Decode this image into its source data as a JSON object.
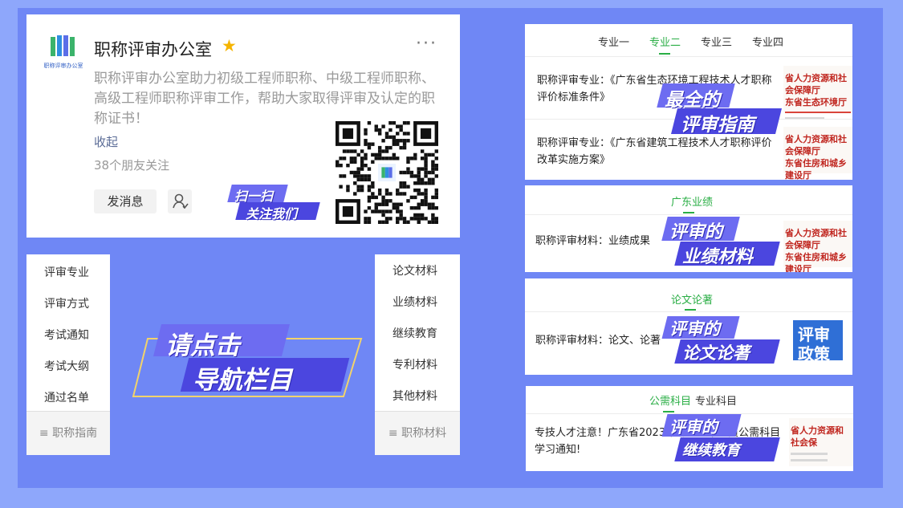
{
  "profile": {
    "logo_text": "职称评审办公室",
    "title": "职称评审办公室",
    "description": "职称评审办公室助力初级工程师职称、中级工程师职称、高级工程师职称评审工作，帮助大家取得评审及认定的职称证书！",
    "collapse": "收起",
    "followers": "38个朋友关注",
    "message_button": "发消息",
    "more": "···"
  },
  "stickers": {
    "scan_line1": "扫一扫",
    "scan_line2": "关注我们",
    "nav_line1": "请点击",
    "nav_line2": "导航栏目",
    "guide_line1": "最全的",
    "guide_line2": "评审指南",
    "perf_line1": "评审的",
    "perf_line2": "业绩材料",
    "paper_line1": "评审的",
    "paper_line2": "论文论著",
    "edu_line1": "评审的",
    "edu_line2": "继续教育",
    "policy_line1": "评审",
    "policy_line2": "政策"
  },
  "menu_left": {
    "items": [
      "评审专业",
      "评审方式",
      "考试通知",
      "考试大纲",
      "通过名单"
    ],
    "footer": "职称指南"
  },
  "menu_right": {
    "items": [
      "论文材料",
      "业绩材料",
      "继续教育",
      "专利材料",
      "其他材料"
    ],
    "footer": "职称材料"
  },
  "card1": {
    "tabs": [
      "专业一",
      "专业二",
      "专业三",
      "专业四"
    ],
    "active_tab": 1,
    "article1": "职称评审专业：《广东省生态环境工程技术人才职称评价标准条件》",
    "article2": "职称评审专业：《广东省建筑工程技术人才职称评价改革实施方案》",
    "thumb1_l1": "省人力资源和社会保障厅",
    "thumb1_l2": "东省生态环境厅",
    "thumb2_l1": "省人力资源和社会保障厅",
    "thumb2_l2": "东省住房和城乡建设厅"
  },
  "card2": {
    "tab": "广东业绩",
    "article": "职称评审材料：业绩成果",
    "thumb_l1": "省人力资源和社会保障厅",
    "thumb_l2": "东省住房和城乡建设厅"
  },
  "card3": {
    "tab": "论文论著",
    "article": "职称评审材料：论文、论著"
  },
  "card4": {
    "tabs": [
      "公需科目",
      "专业科目"
    ],
    "active_tab": 0,
    "article": "专技人才注意！广东省2023年专业技术人员公需科目学习通知!",
    "thumb_l1": "省人力资源和社会保"
  },
  "colors": {
    "accent_green": "#2aae45",
    "sticker_purple": "#6d6cf1",
    "background_blue": "#6f87f5"
  }
}
